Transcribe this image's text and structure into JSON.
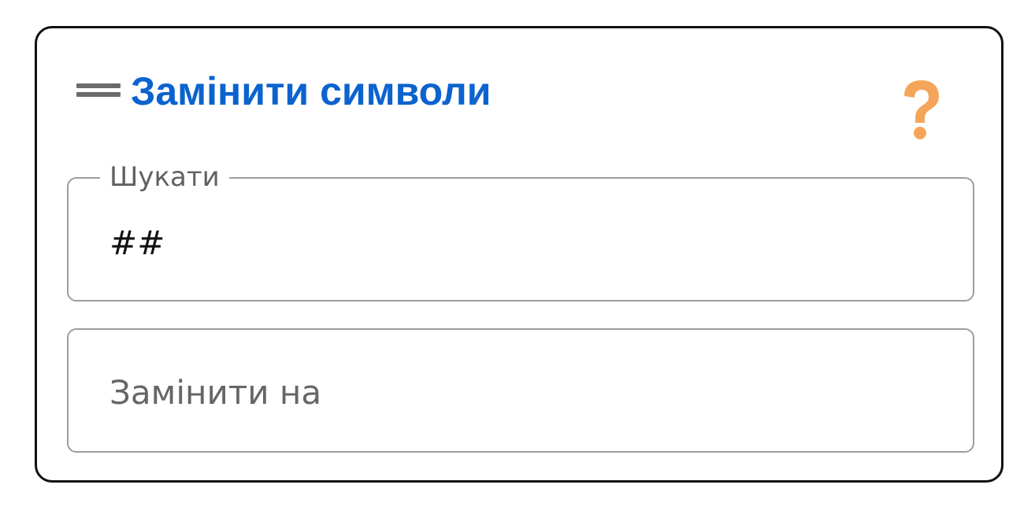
{
  "widget": {
    "title": "Замінити символи",
    "accent_color": "#0b63ce",
    "help_icon_color": "#f5a55a",
    "icons": {
      "drag_handle": "drag-handle-icon",
      "help": "question-mark-icon"
    }
  },
  "search_field": {
    "label": "Шукати",
    "value": "##"
  },
  "replace_field": {
    "placeholder": "Замінити на",
    "value": ""
  }
}
